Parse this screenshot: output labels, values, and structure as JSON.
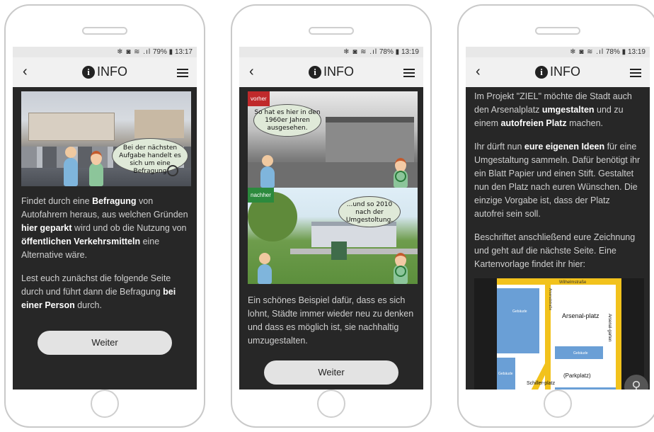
{
  "screens": [
    {
      "status": {
        "icons": "❄ ◙ ≋ .ıl",
        "battery": "79%",
        "time": "13:17"
      },
      "title": "INFO",
      "bubble": "Bei der nächsten Aufgabe handelt es sich um eine Befragung",
      "paragraph1": [
        "Findet durch eine ",
        "Befragung",
        " von Autofahrern heraus, aus welchen Gründen ",
        "hier geparkt",
        " wird und ob die Nutzung von ",
        "öffentlichen Verkehrsmitteln",
        " eine Alternative wäre."
      ],
      "paragraph2": [
        "Lest euch zunächst die folgende Seite durch und führt dann die Befragung ",
        "bei einer Person",
        " durch."
      ],
      "button": "Weiter"
    },
    {
      "status": {
        "icons": "❄ ◙ ≋ .ıl",
        "battery": "78%",
        "time": "13:19"
      },
      "title": "INFO",
      "tag_before": "vorher",
      "bubble_before": "So hat es hier in den 1960er Jahren ausgesehen.",
      "tag_after": "nachher",
      "bubble_after": "...und so 2010 nach der Umgestoltung.",
      "paragraph": "Ein schönes Beispiel dafür, dass es sich lohnt, Städte immer wieder neu zu denken und dass es möglich ist, sie nachhaltig umzugestalten.",
      "button": "Weiter"
    },
    {
      "status": {
        "icons": "❄ ◙ ≋ .ıl",
        "battery": "78%",
        "time": "13:19"
      },
      "title": "INFO",
      "paragraph1": [
        "Im Projekt \"ZIEL\" möchte die Stadt auch den Arsenalplatz ",
        "umgestalten",
        " und zu einem ",
        "autofreien Platz",
        " machen."
      ],
      "paragraph2": [
        "Ihr dürft nun ",
        "eure eigenen Ideen",
        " für eine Umgestaltung sammeln. Dafür benötigt ihr ein Blatt Papier und einen Stift. Gestaltet nun den Platz nach euren Wünschen. Die einzige Vorgabe ist, dass der Platz autofrei sein soll."
      ],
      "paragraph3": "Beschriftet anschließend eure Zeichnung und geht auf die nächste Seite. Eine Kartenvorlage findet ihr hier:",
      "map": {
        "street_top": "Wilhelmstraße",
        "gebaeude": "Gebäude",
        "arsenalstrasse": "Arsenalstraße",
        "arsenalplatz": "Arsenal-platz",
        "arsenalgarten": "Arsenal-garten",
        "parkplatz": "(Parkplatz)",
        "schillerplatz": "Schiller-platz"
      }
    }
  ],
  "colors": {
    "screen_bg": "#272727",
    "appbar_bg": "#f1f1f1",
    "text": "#cfcfcf",
    "tag_before": "#c0292b",
    "tag_after": "#2c8a3d",
    "map_building": "#6a9fd6",
    "map_road": "#f2c21c"
  }
}
